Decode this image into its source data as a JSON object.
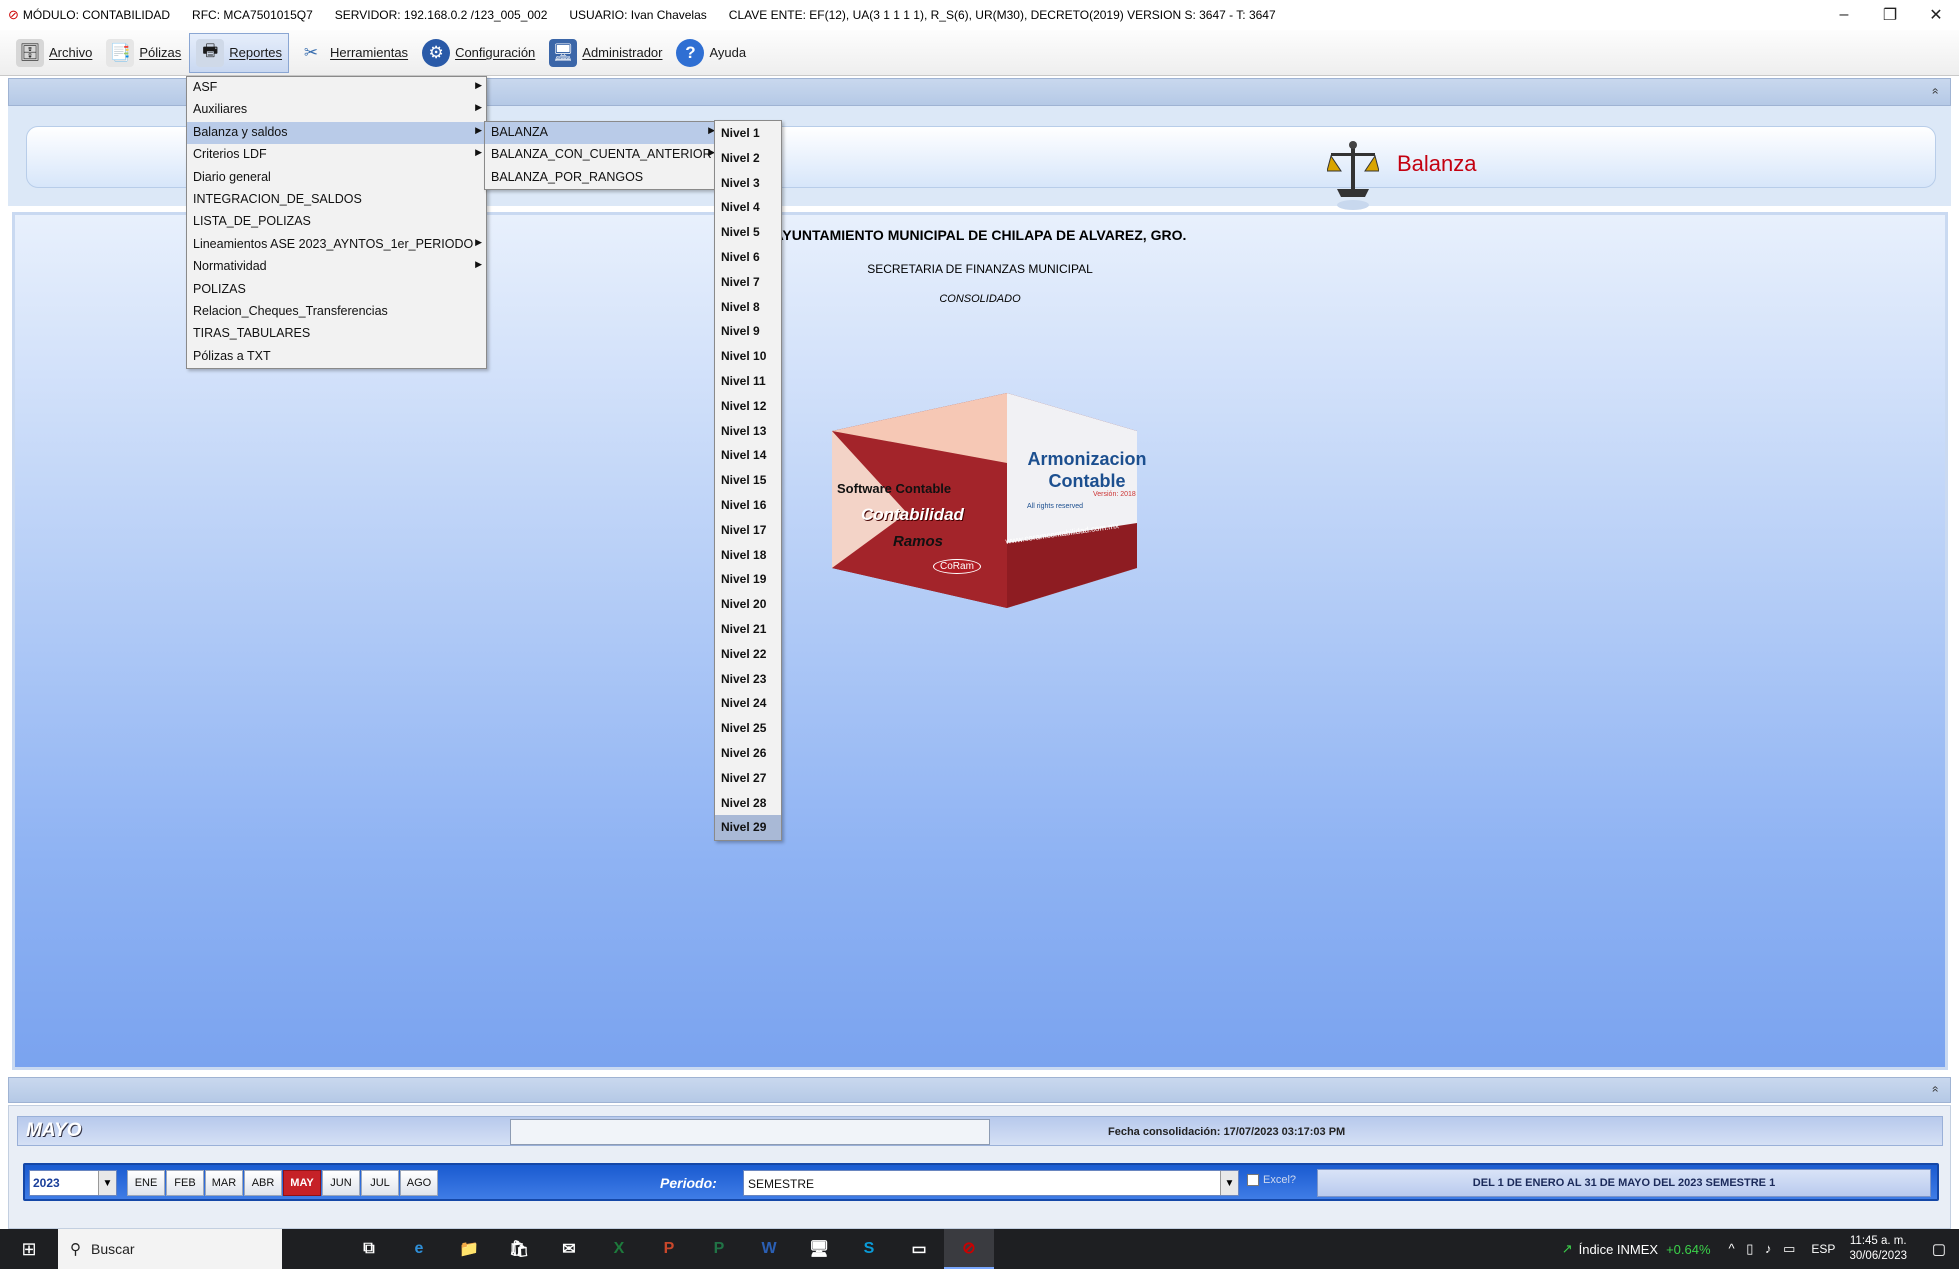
{
  "titlebar": {
    "modulo": "MÓDULO: CONTABILIDAD",
    "rfc": "RFC: MCA7501015Q7",
    "servidor": "SERVIDOR: 192.168.0.2 /123_005_002",
    "usuario": "USUARIO: Ivan Chavelas",
    "clave": "CLAVE ENTE: EF(12), UA(3 1 1 1 1), R_S(6), UR(M30), DECRETO(2019) VERSION S: 3647 - T: 3647",
    "minimize": "–",
    "restore": "❐",
    "close": "✕"
  },
  "toolbar": {
    "items": [
      {
        "label": "Archivo",
        "icon": "🗄"
      },
      {
        "label": "Pólizas",
        "icon": "📑"
      },
      {
        "label": "Reportes",
        "icon": "🖶"
      },
      {
        "label": "Herramientas",
        "icon": "✂"
      },
      {
        "label": "Configuración",
        "icon": "⚙"
      },
      {
        "label": "Administrador",
        "icon": "🖥"
      },
      {
        "label": "Ayuda",
        "icon": "?"
      }
    ]
  },
  "collapse_glyph": "»",
  "header": {
    "title": "Balanza"
  },
  "main": {
    "org_name": "AYUNTAMIENTO MUNICIPAL DE CHILAPA DE ALVAREZ, GRO.",
    "department": "SECRETARIA DE FINANZAS MUNICIPAL",
    "subtitle": "CONSOLIDADO"
  },
  "logo": {
    "brand1": "Armonizacion Contable",
    "brand2": "Software Contable",
    "brand3": "Contabilidad",
    "brand4": "Ramos",
    "brand5": "www.coramcontabilidad.com.mx",
    "version": "Versión: 2018",
    "rights": "All rights reserved",
    "badge": "CoRam"
  },
  "menu_reportes": [
    {
      "label": "ASF",
      "submenu": true
    },
    {
      "label": "Auxiliares",
      "submenu": true
    },
    {
      "label": "Balanza y saldos",
      "submenu": true,
      "highlighted": true
    },
    {
      "label": "Criterios LDF",
      "submenu": true
    },
    {
      "label": "Diario general",
      "submenu": false
    },
    {
      "label": "INTEGRACION_DE_SALDOS",
      "submenu": false
    },
    {
      "label": "LISTA_DE_POLIZAS",
      "submenu": false
    },
    {
      "label": "Lineamientos ASE 2023_AYNTOS_1er_PERIODO",
      "submenu": true
    },
    {
      "label": "Normatividad",
      "submenu": true
    },
    {
      "label": "POLIZAS",
      "submenu": false
    },
    {
      "label": "Relacion_Cheques_Transferencias",
      "submenu": false
    },
    {
      "label": "TIRAS_TABULARES",
      "submenu": false
    },
    {
      "label": "Pólizas a TXT",
      "submenu": false
    }
  ],
  "menu_balanza": [
    {
      "label": "BALANZA",
      "submenu": true,
      "highlighted": true
    },
    {
      "label": "BALANZA_CON_CUENTA_ANTERIOR",
      "submenu": true
    },
    {
      "label": "BALANZA_POR_RANGOS",
      "submenu": false
    }
  ],
  "menu_niveles": [
    "Nivel 1",
    "Nivel 2",
    "Nivel 3",
    "Nivel 4",
    "Nivel 5",
    "Nivel 6",
    "Nivel 7",
    "Nivel 8",
    "Nivel 9",
    "Nivel 10",
    "Nivel 11",
    "Nivel 12",
    "Nivel 13",
    "Nivel 14",
    "Nivel 15",
    "Nivel 16",
    "Nivel 17",
    "Nivel 18",
    "Nivel 19",
    "Nivel 20",
    "Nivel 21",
    "Nivel 22",
    "Nivel 23",
    "Nivel 24",
    "Nivel 25",
    "Nivel 26",
    "Nivel 27",
    "Nivel 28",
    "Nivel 29"
  ],
  "niveles_highlighted_index": 28,
  "bottom": {
    "month_name": "MAYO",
    "consolidation_date": "Fecha consolidación: 17/07/2023 03:17:03 PM",
    "year": "2023",
    "months": [
      "ENE",
      "FEB",
      "MAR",
      "ABR",
      "MAY",
      "JUN",
      "JUL",
      "AGO"
    ],
    "selected_month": "MAY",
    "periodo_label": "Periodo:",
    "periodo_value": "SEMESTRE",
    "excel_label": "Excel?",
    "range_label": "DEL 1 DE ENERO AL 31 DE MAYO DEL 2023 SEMESTRE 1"
  },
  "taskbar": {
    "search_placeholder": "Buscar",
    "apps": [
      {
        "name": "task-view",
        "glyph": "⧉"
      },
      {
        "name": "edge",
        "glyph": "e"
      },
      {
        "name": "file-explorer",
        "glyph": "📁"
      },
      {
        "name": "store",
        "glyph": "🛍"
      },
      {
        "name": "mail",
        "glyph": "✉"
      },
      {
        "name": "excel",
        "glyph": "X"
      },
      {
        "name": "powerpoint",
        "glyph": "P"
      },
      {
        "name": "project",
        "glyph": "P"
      },
      {
        "name": "word",
        "glyph": "W"
      },
      {
        "name": "remote-desktop",
        "glyph": "🖥"
      },
      {
        "name": "skype",
        "glyph": "S"
      },
      {
        "name": "terminal",
        "glyph": "▭"
      },
      {
        "name": "contabilidad-app",
        "glyph": "⊘"
      }
    ],
    "inmex_label": "Índice INMEX",
    "inmex_change": "+0.64%",
    "language": "ESP",
    "time": "11:45 a. m.",
    "date": "30/06/2023"
  },
  "colors": {
    "accent_red": "#c62127",
    "header_title": "#c40010",
    "menu_highlight": "#b9cbe8"
  }
}
